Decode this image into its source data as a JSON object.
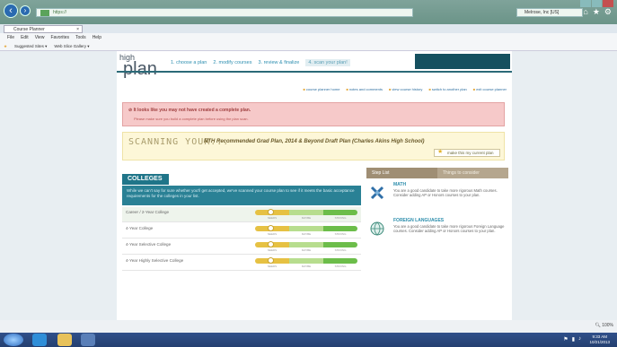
{
  "browser": {
    "address": "https://",
    "search": "Melrose, Inc [US]",
    "tab_label": "Course Planner",
    "menu": [
      "File",
      "Edit",
      "View",
      "Favorites",
      "Tools",
      "Help"
    ],
    "favorites": [
      "Suggested Sites ▾",
      "Web Slice Gallery ▾"
    ],
    "zoom": "100%"
  },
  "app": {
    "logo_top": "high",
    "logo_main": "plan",
    "steps": [
      {
        "label": "1. choose a plan"
      },
      {
        "label": "2. modify courses"
      },
      {
        "label": "3. review & finalize"
      },
      {
        "label": "4. scan your plan!"
      }
    ],
    "tools": [
      "course planner home",
      "notes and comments",
      "view course history",
      "switch to another plan",
      "exit course planner"
    ]
  },
  "alert": {
    "title": "It looks like you may not have created a complete plan.",
    "message": "Please make sure you build a complete plan before using the plan scan."
  },
  "scan": {
    "title": "SCANNING YOUR...",
    "plan_name": "NTH Recommended Grad Plan, 2014 & Beyond Draft Plan (Charles Akins High School)",
    "make_current": "make this my current plan"
  },
  "colleges": {
    "tab": "COLLEGES",
    "description": "While we can't say for sure whether you'll get accepted, we've scanned your course plan to see if it meets the basic acceptance requirements for the colleges in your list.",
    "bar_labels": [
      "NEEDS",
      "MAYBE",
      "STRONG"
    ],
    "rows": [
      {
        "label": "Career / 2-Year College",
        "marker": 0.15
      },
      {
        "label": "4-Year College",
        "marker": 0.15
      },
      {
        "label": "4-Year Selective College",
        "marker": 0.15
      },
      {
        "label": "4-Year Highly Selective College",
        "marker": 0.15
      }
    ]
  },
  "sidebar": {
    "tabs": [
      "Step List",
      "Things to consider"
    ],
    "items": [
      {
        "title": "MATH",
        "text": "You are a good candidate to take more rigorous Math courses. Consider adding AP or Honors courses to your plan."
      },
      {
        "title": "FOREIGN LANGUAGES",
        "text": "You are a good candidate to take more rigorous Foreign Language courses. Consider adding AP or Honors courses to your plan."
      }
    ]
  },
  "taskbar": {
    "time": "9:33 AM",
    "date": "10/21/2013"
  },
  "colors": {
    "accent": "#1f7589",
    "alert": "#f6c9c9"
  }
}
